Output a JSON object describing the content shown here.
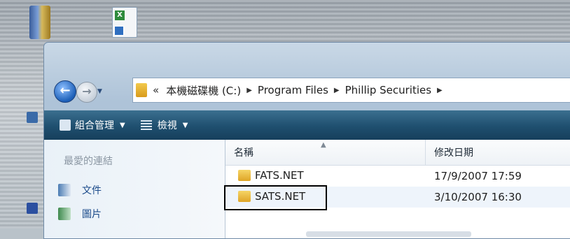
{
  "breadcrumb": {
    "overflow": "«",
    "parts": [
      "本機磁碟機 (C:)",
      "Program Files",
      "Phillip Securities"
    ]
  },
  "toolbar": {
    "organize": "組合管理",
    "views": "檢視"
  },
  "nav_pane": {
    "title": "最愛的連結",
    "links": [
      "文件",
      "圖片"
    ]
  },
  "file_list": {
    "columns": [
      "名稱",
      "修改日期"
    ],
    "rows": [
      {
        "name": "FATS.NET",
        "modified": "17/9/2007 17:59"
      },
      {
        "name": "SATS.NET",
        "modified": "3/10/2007 16:30"
      }
    ]
  },
  "colors": {
    "toolbar_bg": "#1f4f6f",
    "link": "#1a4a8a",
    "folder": "#f2c94c"
  }
}
